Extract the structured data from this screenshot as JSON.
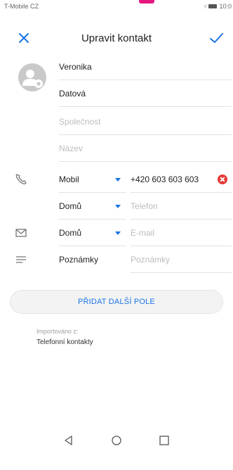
{
  "status_bar": {
    "carrier": "T-Mobile CZ",
    "time": "10:0"
  },
  "header": {
    "title": "Upravit kontakt",
    "close_icon": "close-icon",
    "confirm_icon": "check-icon"
  },
  "name": {
    "first_name": "Veronika",
    "last_name": "Datová",
    "company_placeholder": "Společnost",
    "title_placeholder": "Název"
  },
  "phone": {
    "label": "Mobil",
    "value": "+420 603 603 603"
  },
  "phone2": {
    "label": "Domů",
    "placeholder": "Telefon"
  },
  "email": {
    "label": "Domů",
    "placeholder": "E-mail"
  },
  "notes": {
    "label": "Poznámky",
    "placeholder": "Poznámky"
  },
  "add_field_button": "PŘIDAT DALŠÍ POLE",
  "import": {
    "label": "Importováno z:",
    "source": "Telefonní kontakty"
  },
  "colors": {
    "accent": "#1a73e8",
    "clear": "#e53935",
    "brand": "#e5177e"
  }
}
